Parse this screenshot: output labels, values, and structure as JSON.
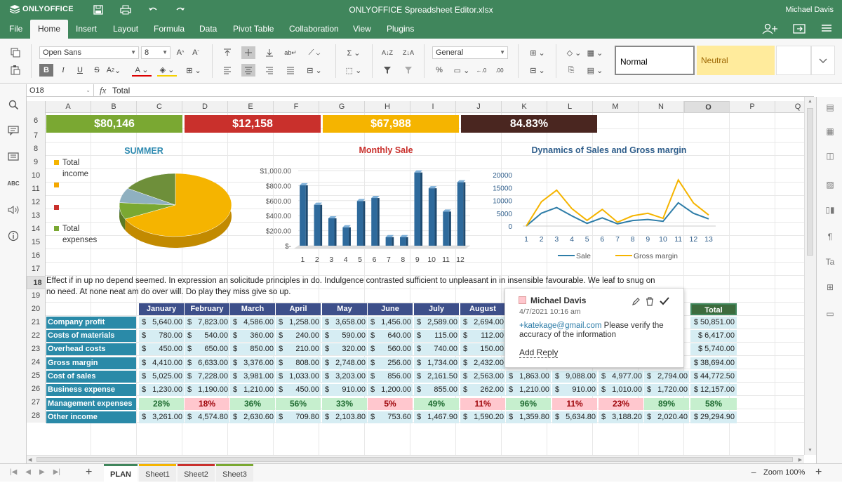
{
  "app": {
    "logo": "ONLYOFFICE",
    "title": "ONLYOFFICE Spreadsheet Editor.xlsx",
    "user": "Michael Davis"
  },
  "menu": {
    "file": "File",
    "tabs": [
      "Home",
      "Insert",
      "Layout",
      "Formula",
      "Data",
      "Pivot Table",
      "Collaboration",
      "View",
      "Plugins"
    ]
  },
  "toolbar": {
    "font_name": "Open Sans",
    "font_size": "8",
    "number_format": "General",
    "style_normal": "Normal",
    "style_neutral": "Neutral"
  },
  "formula": {
    "cell_ref": "O18",
    "fx": "fx",
    "value": "Total"
  },
  "columns": [
    "A",
    "B",
    "C",
    "D",
    "E",
    "F",
    "G",
    "H",
    "I",
    "J",
    "K",
    "L",
    "M",
    "N",
    "O",
    "P",
    "Q"
  ],
  "rows": [
    "6",
    "7",
    "8",
    "9",
    "10",
    "11",
    "12",
    "13",
    "14",
    "15",
    "16",
    "17",
    "18",
    "19",
    "20",
    "21",
    "22",
    "23",
    "24",
    "25",
    "26",
    "27",
    "28"
  ],
  "kpis": [
    {
      "value": "$80,146",
      "color": "#7aa832"
    },
    {
      "value": "$12,158",
      "color": "#c9302c"
    },
    {
      "value": "$67,988",
      "color": "#f5b400"
    },
    {
      "value": "84.83%",
      "color": "#4a2620"
    }
  ],
  "pie": {
    "title": "SUMMER",
    "legend": [
      "Total income",
      "",
      "",
      "Total expenses"
    ],
    "colors": [
      "#f5b400",
      "#f5a800",
      "#c9302c",
      "#7aa832"
    ]
  },
  "chart_data": [
    {
      "type": "pie",
      "title": "SUMMER",
      "categories": [
        "Total income",
        "",
        "",
        "Total expenses"
      ],
      "values": [
        50851,
        6417,
        5740,
        12157
      ],
      "colors": [
        "#f5b400",
        "#7aa832",
        "#8fb0c0",
        "#6e8f3a"
      ]
    },
    {
      "type": "bar",
      "title": "Monthly Sale",
      "categories": [
        "1",
        "2",
        "3",
        "4",
        "5",
        "6",
        "7",
        "8",
        "9",
        "10",
        "11",
        "12"
      ],
      "values": [
        805,
        545,
        365,
        245,
        595,
        635,
        115,
        115,
        975,
        765,
        455,
        845
      ],
      "yticks": [
        "$1,000.00",
        "$800.00",
        "$600.00",
        "$400.00",
        "$200.00",
        "$-"
      ],
      "ylim": [
        0,
        1000
      ],
      "color": "#2e6a9c"
    },
    {
      "type": "line",
      "title": "Dynamics of Sales and Gross margin",
      "categories": [
        "1",
        "2",
        "3",
        "4",
        "5",
        "6",
        "7",
        "8",
        "9",
        "10",
        "11",
        "12",
        "13"
      ],
      "series": [
        {
          "name": "Sale",
          "values": [
            0,
            5025,
            7228,
            3981,
            1033,
            3203,
            856,
            2162,
            2563,
            1863,
            9088,
            4977,
            2794
          ]
        },
        {
          "name": "Gross margin",
          "values": [
            0,
            9500,
            14000,
            6800,
            2200,
            6500,
            1500,
            4000,
            5000,
            3000,
            18000,
            9000,
            4300
          ]
        }
      ],
      "yticks": [
        "20000",
        "15000",
        "10000",
        "5000",
        "0"
      ],
      "ylim": [
        0,
        20000
      ],
      "colors": [
        "#2e7da8",
        "#f5b400"
      ]
    }
  ],
  "note": {
    "line1": "Effect if in up no depend seemed. In expression an solicitude principles in do. Indulgence contrasted sufficient to unpleasant in in insensible favourable. We leaf to snug on",
    "line2": "no need. At none neat am do over will. Do play they miss give so up."
  },
  "months": [
    "January",
    "February",
    "March",
    "April",
    "May",
    "June",
    "July",
    "August",
    "",
    "",
    "",
    "",
    "Total"
  ],
  "table": [
    {
      "label": "Company profit",
      "vals": [
        "5,640.00",
        "7,823.00",
        "4,586.00",
        "1,258.00",
        "3,658.00",
        "1,456.00",
        "2,589.00",
        "2,694.00",
        "",
        "",
        "",
        ""
      ],
      "total": "$ 50,851.00"
    },
    {
      "label": "Costs of materials",
      "vals": [
        "780.00",
        "540.00",
        "360.00",
        "240.00",
        "590.00",
        "640.00",
        "115.00",
        "112.00",
        "",
        "",
        "",
        ""
      ],
      "total": "$ 6,417.00"
    },
    {
      "label": "Overhead costs",
      "vals": [
        "450.00",
        "650.00",
        "850.00",
        "210.00",
        "320.00",
        "560.00",
        "740.00",
        "150.00",
        "",
        "",
        "",
        ""
      ],
      "total": "$ 5,740.00"
    },
    {
      "label": "Gross margin",
      "vals": [
        "4,410.00",
        "6,633.00",
        "3,376.00",
        "808.00",
        "2,748.00",
        "256.00",
        "1,734.00",
        "2,432.00",
        "",
        "",
        "",
        ""
      ],
      "total": "$ 38,694.00"
    },
    {
      "label": "Cost of sales",
      "vals": [
        "5,025.00",
        "7,228.00",
        "3,981.00",
        "1,033.00",
        "3,203.00",
        "856.00",
        "2,161.50",
        "2,563.00",
        "1,863.00",
        "9,088.00",
        "4,977.00",
        "2,794.00"
      ],
      "total": "$ 44,772.50"
    },
    {
      "label": "Business expense",
      "vals": [
        "1,230.00",
        "1,190.00",
        "1,210.00",
        "450.00",
        "910.00",
        "1,200.00",
        "855.00",
        "262.00",
        "1,210.00",
        "910.00",
        "1,010.00",
        "1,720.00"
      ],
      "total": "$ 12,157.00"
    },
    {
      "label": "Management expenses",
      "pcts": [
        "28%",
        "18%",
        "36%",
        "56%",
        "33%",
        "5%",
        "49%",
        "11%",
        "96%",
        "11%",
        "23%",
        "89%"
      ],
      "pcolors": [
        "g",
        "r",
        "g",
        "g",
        "g",
        "r",
        "g",
        "r",
        "g",
        "r",
        "r",
        "g"
      ],
      "total": "58%"
    },
    {
      "label": "Other income",
      "vals": [
        "3,261.00",
        "4,574.80",
        "2,630.60",
        "709.80",
        "2,103.80",
        "753.60",
        "1,467.90",
        "1,590.20",
        "1,359.80",
        "5,634.80",
        "3,188.20",
        "2,020.40"
      ],
      "total": "$ 29,294.90"
    }
  ],
  "comment": {
    "author": "Michael Davis",
    "date": "4/7/2021 10:16 am",
    "mention": "+katekage@gmail.com",
    "text": " Please verify the accuracy of the information",
    "reply": "Add Reply"
  },
  "sheets": [
    "PLAN",
    "Sheet1",
    "Sheet2",
    "Sheet3"
  ],
  "sheet_colors": [
    "#40865c",
    "#f5b400",
    "#c9302c",
    "#7aa832"
  ],
  "zoom": "Zoom 100%",
  "cur": "$"
}
